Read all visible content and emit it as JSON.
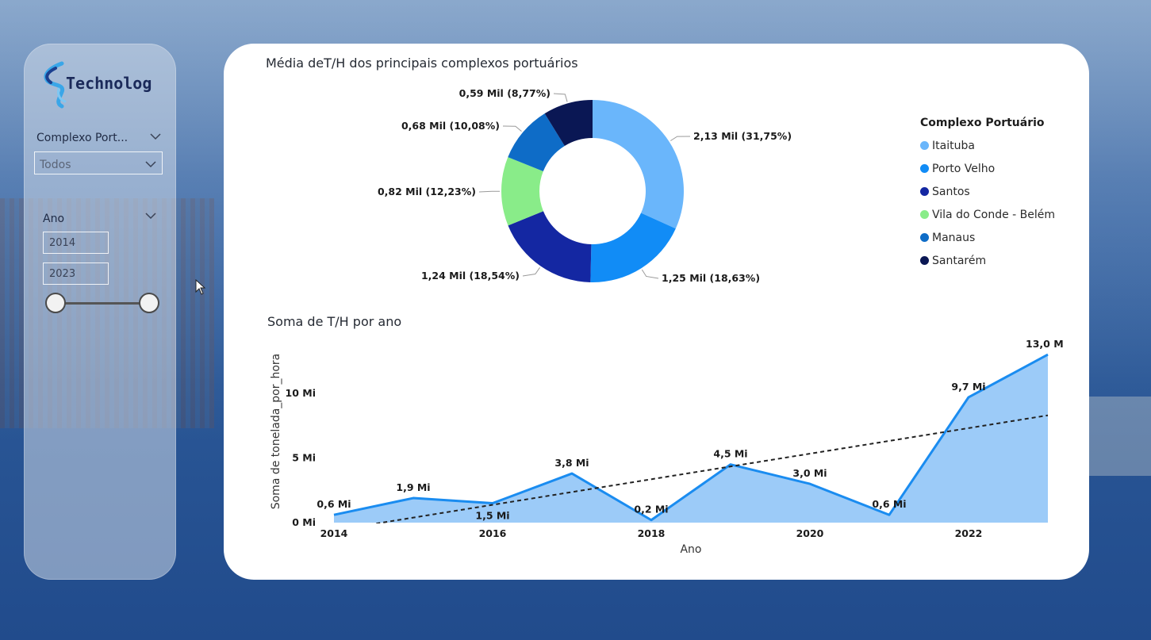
{
  "sidebar": {
    "logo_text": "Technolog",
    "complexo_title": "Complexo Port...",
    "complexo_value": "Todos",
    "ano_title": "Ano",
    "ano_start": "2014",
    "ano_end": "2023"
  },
  "colors": {
    "itaituba": "#6ab6fb",
    "porto_velho": "#118cf6",
    "santos": "#1427a2",
    "vila_do_conde": "#89ec89",
    "manaus": "#0e6cc7",
    "santarem": "#0a1754",
    "area_fill": "#9ccbf8",
    "area_line": "#1a8cf0"
  },
  "chart_data": [
    {
      "type": "pie",
      "title": "Média deT/H dos principais complexos portuários",
      "legend_title": "Complexo Portuário",
      "legend_position": "right",
      "slices": [
        {
          "name": "Itaituba",
          "value": 2.13,
          "percent": 31.75,
          "label": "2,13 Mil (31,75%)",
          "color": "#6ab6fb"
        },
        {
          "name": "Porto Velho",
          "value": 1.25,
          "percent": 18.63,
          "label": "1,25 Mil (18,63%)",
          "color": "#118cf6"
        },
        {
          "name": "Santos",
          "value": 1.24,
          "percent": 18.54,
          "label": "1,24 Mil (18,54%)",
          "color": "#1427a2"
        },
        {
          "name": "Vila do Conde - Belém",
          "value": 0.82,
          "percent": 12.23,
          "label": "0,82 Mil (12,23%)",
          "color": "#89ec89"
        },
        {
          "name": "Manaus",
          "value": 0.68,
          "percent": 10.08,
          "label": "0,68 Mil (10,08%)",
          "color": "#0e6cc7"
        },
        {
          "name": "Santarém",
          "value": 0.59,
          "percent": 8.77,
          "label": "0,59 Mil (8,77%)",
          "color": "#0a1754"
        }
      ]
    },
    {
      "type": "area",
      "title": "Soma de T/H por ano",
      "xlabel": "Ano",
      "ylabel": "Soma de tonelada_por_hora",
      "x": [
        2014,
        2015,
        2016,
        2017,
        2018,
        2019,
        2020,
        2021,
        2022,
        2023
      ],
      "values": [
        0.6,
        1.9,
        1.5,
        3.8,
        0.2,
        4.5,
        3.0,
        0.6,
        9.7,
        13.0
      ],
      "data_labels": [
        "0,6 Mi",
        "1,9 Mi",
        "1,5 Mi",
        "3,8 Mi",
        "0,2 Mi",
        "4,5 Mi",
        "3,0 Mi",
        "0,6 Mi",
        "9,7 Mi",
        "13,0 Mi"
      ],
      "x_ticks": [
        "2014",
        "2016",
        "2018",
        "2020",
        "2022"
      ],
      "y_ticks": [
        "0 Mi",
        "5 Mi",
        "10 Mi"
      ],
      "ylim": [
        0,
        13.5
      ],
      "trendline": {
        "style": "dashed",
        "start": -0.6,
        "end": 8.3
      },
      "grid": false
    }
  ]
}
